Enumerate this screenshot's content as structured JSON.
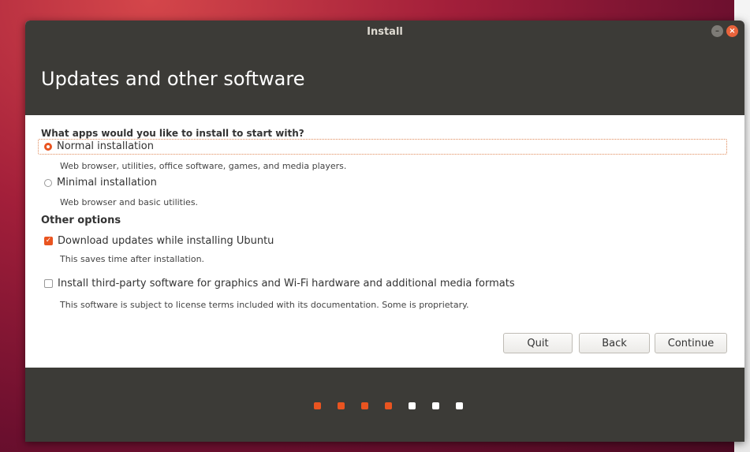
{
  "window": {
    "title": "Install"
  },
  "header": {
    "title": "Updates and other software"
  },
  "question": "What apps would you like to install to start with?",
  "options": {
    "normal": {
      "label": "Normal installation",
      "desc": "Web browser, utilities, office software, games, and media players."
    },
    "minimal": {
      "label": "Minimal installation",
      "desc": "Web browser and basic utilities."
    }
  },
  "other": {
    "heading": "Other options",
    "download": {
      "label": "Download updates while installing Ubuntu",
      "desc": "This saves time after installation."
    },
    "thirdparty": {
      "label": "Install third-party software for graphics and Wi-Fi hardware and additional media formats",
      "desc": "This software is subject to license terms included with its documentation. Some is proprietary."
    }
  },
  "buttons": {
    "quit": "Quit",
    "back": "Back",
    "continue": "Continue"
  },
  "progress": {
    "total": 7,
    "completed": 4
  },
  "colors": {
    "accent": "#e95420",
    "dark": "#3c3b37"
  }
}
